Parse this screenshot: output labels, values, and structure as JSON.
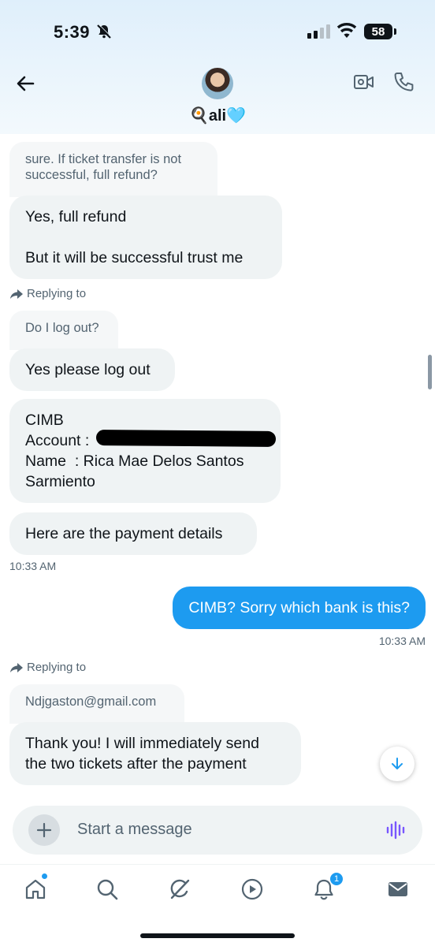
{
  "status_bar": {
    "time": "5:39",
    "battery": "58",
    "icons": [
      "bell-off-icon",
      "signal-icon",
      "wifi-icon",
      "battery-icon"
    ]
  },
  "header": {
    "name": "🍳ali🩵",
    "icons": [
      "back-arrow-icon",
      "avatar",
      "video-icon",
      "phone-icon"
    ]
  },
  "messages": {
    "quote1": "sure. If ticket transfer is not successful, full refund?",
    "bubble1_line1": "Yes, full refund",
    "bubble1_line2": "But it will be successful trust me",
    "reply1": "Replying to",
    "quote2": "Do I log out?",
    "bubble2": "Yes please log out",
    "bank_line1": "CIMB",
    "bank_line2": "Account :",
    "bank_line3": "Name  : Rica Mae Delos Santos",
    "bank_line4": "Sarmiento",
    "bubble4": "Here are the payment details",
    "ts1": "10:33 AM",
    "outgoing": "CIMB? Sorry which bank is this?",
    "ts2": "10:33 AM",
    "reply2": "Replying to",
    "quote3": "Ndjgaston@gmail.com",
    "bubble5_line1": "Thank you! I will immediately send",
    "bubble5_line2": "the two tickets after the payment"
  },
  "composer": {
    "placeholder": "Start a message"
  },
  "tabbar": {
    "notifications_badge": "1",
    "tabs": [
      "home-icon",
      "search-icon",
      "grok-icon",
      "video-icon",
      "notifications-icon",
      "messages-icon"
    ]
  },
  "colors": {
    "accent": "#1d9bf0",
    "bubble_in": "#eff3f4",
    "secondary_text": "#536471"
  }
}
